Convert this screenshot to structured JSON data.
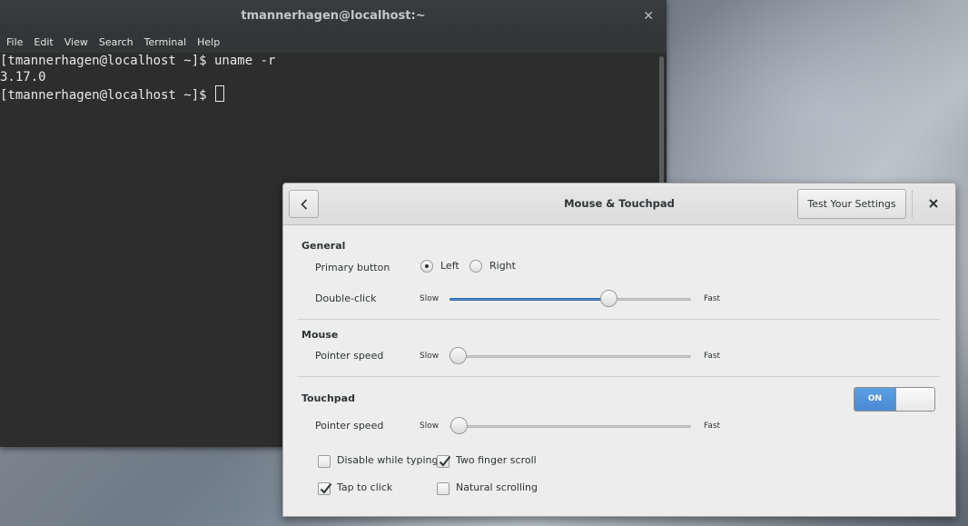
{
  "terminal": {
    "title": "tmannerhagen@localhost:~",
    "close_glyph": "✕",
    "menu": [
      "File",
      "Edit",
      "View",
      "Search",
      "Terminal",
      "Help"
    ],
    "lines": [
      "[tmannerhagen@localhost ~]$ uname -r",
      "3.17.0",
      "[tmannerhagen@localhost ~]$ "
    ]
  },
  "settings": {
    "title": "Mouse & Touchpad",
    "test_button": "Test Your Settings",
    "general": {
      "title": "General",
      "primary_button_label": "Primary button",
      "primary_left": "Left",
      "primary_right": "Right",
      "primary_selected": "Left",
      "double_click_label": "Double-click",
      "double_click_value": 0.66
    },
    "mouse": {
      "title": "Mouse",
      "pointer_speed_label": "Pointer speed",
      "pointer_speed_value": 0.0
    },
    "touchpad": {
      "title": "Touchpad",
      "switch_label": "ON",
      "switch_on": true,
      "pointer_speed_label": "Pointer speed",
      "pointer_speed_value": 0.04,
      "disable_while_typing": "Disable while typing",
      "disable_while_typing_checked": false,
      "two_finger_scroll": "Two finger scroll",
      "two_finger_scroll_checked": true,
      "tap_to_click": "Tap to click",
      "tap_to_click_checked": true,
      "natural_scrolling": "Natural scrolling",
      "natural_scrolling_checked": false
    },
    "slow_label": "Slow",
    "fast_label": "Fast"
  },
  "colors": {
    "accent": "#4a90d9",
    "terminal_bg": "#2d2d2d"
  }
}
